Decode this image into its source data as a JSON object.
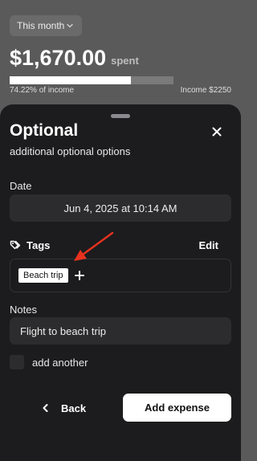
{
  "summary": {
    "period": "This month",
    "amount": "$1,670.00",
    "spent_label": "spent",
    "progress_fraction": 0.7422,
    "percent_text": "74.22% of income",
    "income_text": "Income $2250"
  },
  "sheet": {
    "title": "Optional",
    "subtitle": "additional optional options",
    "date_label": "Date",
    "date_value": "Jun 4, 2025 at 10:14 AM",
    "tags_label": "Tags",
    "edit_label": "Edit",
    "tags": [
      "Beach trip"
    ],
    "notes_label": "Notes",
    "notes_value": "Flight to beach trip",
    "add_another_label": "add another",
    "back_label": "Back",
    "submit_label": "Add expense"
  },
  "colors": {
    "annotation_arrow": "#e8321e"
  }
}
